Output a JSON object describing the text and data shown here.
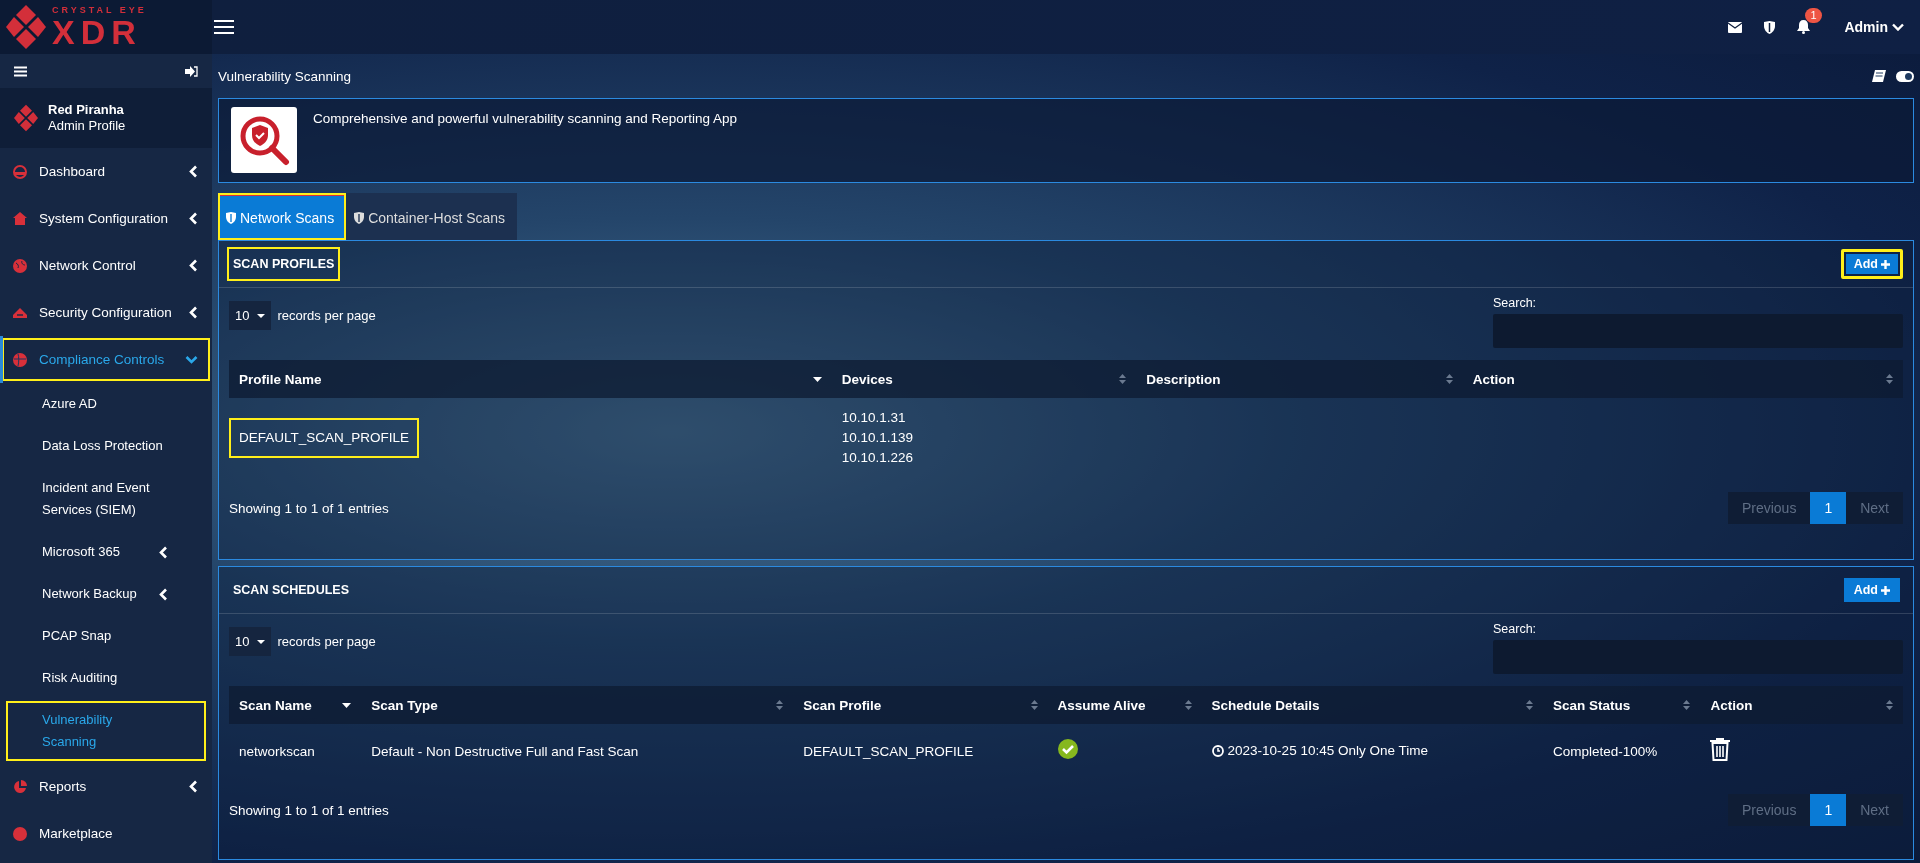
{
  "brand": {
    "tagline": "CRYSTAL EYE",
    "name": "XDR"
  },
  "topbar": {
    "notification_count": "1",
    "user": "Admin"
  },
  "profile": {
    "name": "Red Piranha",
    "role": "Admin Profile"
  },
  "sidebar": {
    "items": [
      {
        "label": "Dashboard",
        "expandable": true,
        "expanded": false,
        "selected": false,
        "highlighted": false
      },
      {
        "label": "System Configuration",
        "expandable": true,
        "expanded": false,
        "selected": false,
        "highlighted": false
      },
      {
        "label": "Network Control",
        "expandable": true,
        "expanded": false,
        "selected": false,
        "highlighted": false
      },
      {
        "label": "Security Configuration",
        "expandable": true,
        "expanded": false,
        "selected": false,
        "highlighted": false
      },
      {
        "label": "Compliance Controls",
        "expandable": true,
        "expanded": true,
        "selected": true,
        "highlighted": true,
        "children": [
          {
            "label": "Azure AD",
            "expandable": false,
            "selected": false,
            "highlighted": false
          },
          {
            "label": "Data Loss Protection",
            "expandable": false,
            "selected": false,
            "highlighted": false
          },
          {
            "label": "Incident and Event Services (SIEM)",
            "expandable": false,
            "selected": false,
            "highlighted": false
          },
          {
            "label": "Microsoft 365",
            "expandable": true,
            "selected": false,
            "highlighted": false
          },
          {
            "label": "Network Backup",
            "expandable": true,
            "selected": false,
            "highlighted": false
          },
          {
            "label": "PCAP Snap",
            "expandable": false,
            "selected": false,
            "highlighted": false
          },
          {
            "label": "Risk Auditing",
            "expandable": false,
            "selected": false,
            "highlighted": false
          },
          {
            "label": "Vulnerability Scanning",
            "expandable": false,
            "selected": true,
            "highlighted": true
          }
        ]
      },
      {
        "label": "Reports",
        "expandable": true,
        "expanded": false,
        "selected": false,
        "highlighted": false
      },
      {
        "label": "Marketplace",
        "selected": false,
        "highlighted": false
      }
    ]
  },
  "page": {
    "title": "Vulnerability Scanning",
    "app_description": "Comprehensive and powerful vulnerability scanning and Reporting App"
  },
  "tabs": [
    {
      "label": "Network Scans",
      "selected": true,
      "highlighted": true
    },
    {
      "label": "Container-Host Scans",
      "selected": false,
      "highlighted": false
    }
  ],
  "panels": [
    {
      "title": "SCAN PROFILES",
      "title_highlighted": true,
      "add_button": {
        "label": "Add",
        "highlighted": true
      },
      "page_length": "10",
      "length_label": "records per page",
      "search_label": "Search:",
      "columns": [
        {
          "label": "Profile Name",
          "sorted": true
        },
        {
          "label": "Devices",
          "sorted": false
        },
        {
          "label": "Description",
          "sorted": false
        },
        {
          "label": "Action",
          "sorted": false
        }
      ],
      "rows": [
        {
          "cells": [
            {
              "kind": "text",
              "text": "DEFAULT_SCAN_PROFILE",
              "highlighted": true
            },
            {
              "kind": "lines",
              "lines": [
                "10.10.1.31",
                "10.10.1.139",
                "10.10.1.226"
              ]
            },
            {
              "kind": "empty"
            },
            {
              "kind": "empty"
            }
          ]
        }
      ],
      "info": "Showing 1 to 1 of 1 entries",
      "pagination": {
        "previous": {
          "label": "Previous",
          "disabled": true
        },
        "pages": [
          {
            "label": "1",
            "selected": true
          }
        ],
        "next": {
          "label": "Next",
          "disabled": true
        }
      }
    },
    {
      "title": "SCAN SCHEDULES",
      "title_highlighted": false,
      "add_button": {
        "label": "Add",
        "highlighted": false
      },
      "page_length": "10",
      "length_label": "records per page",
      "search_label": "Search:",
      "columns": [
        {
          "label": "Scan Name",
          "sorted": true
        },
        {
          "label": "Scan Type",
          "sorted": false
        },
        {
          "label": "Scan Profile",
          "sorted": false
        },
        {
          "label": "Assume Alive",
          "sorted": false
        },
        {
          "label": "Schedule Details",
          "sorted": false
        },
        {
          "label": "Scan Status",
          "sorted": false
        },
        {
          "label": "Action",
          "sorted": false
        }
      ],
      "rows": [
        {
          "cells": [
            {
              "kind": "text",
              "text": "networkscan",
              "highlighted": false
            },
            {
              "kind": "text",
              "text": "Default - Non Destructive Full and Fast Scan",
              "highlighted": false
            },
            {
              "kind": "text",
              "text": "DEFAULT_SCAN_PROFILE",
              "highlighted": false
            },
            {
              "kind": "check",
              "on": true
            },
            {
              "kind": "schedule",
              "text": "2023-10-25 10:45 Only One Time"
            },
            {
              "kind": "text",
              "text": "Completed-100%",
              "highlighted": false
            },
            {
              "kind": "delete"
            }
          ]
        }
      ],
      "info": "Showing 1 to 1 of 1 entries",
      "pagination": {
        "previous": {
          "label": "Previous",
          "disabled": true
        },
        "pages": [
          {
            "label": "1",
            "selected": true
          }
        ],
        "next": {
          "label": "Next",
          "disabled": true
        }
      }
    }
  ]
}
